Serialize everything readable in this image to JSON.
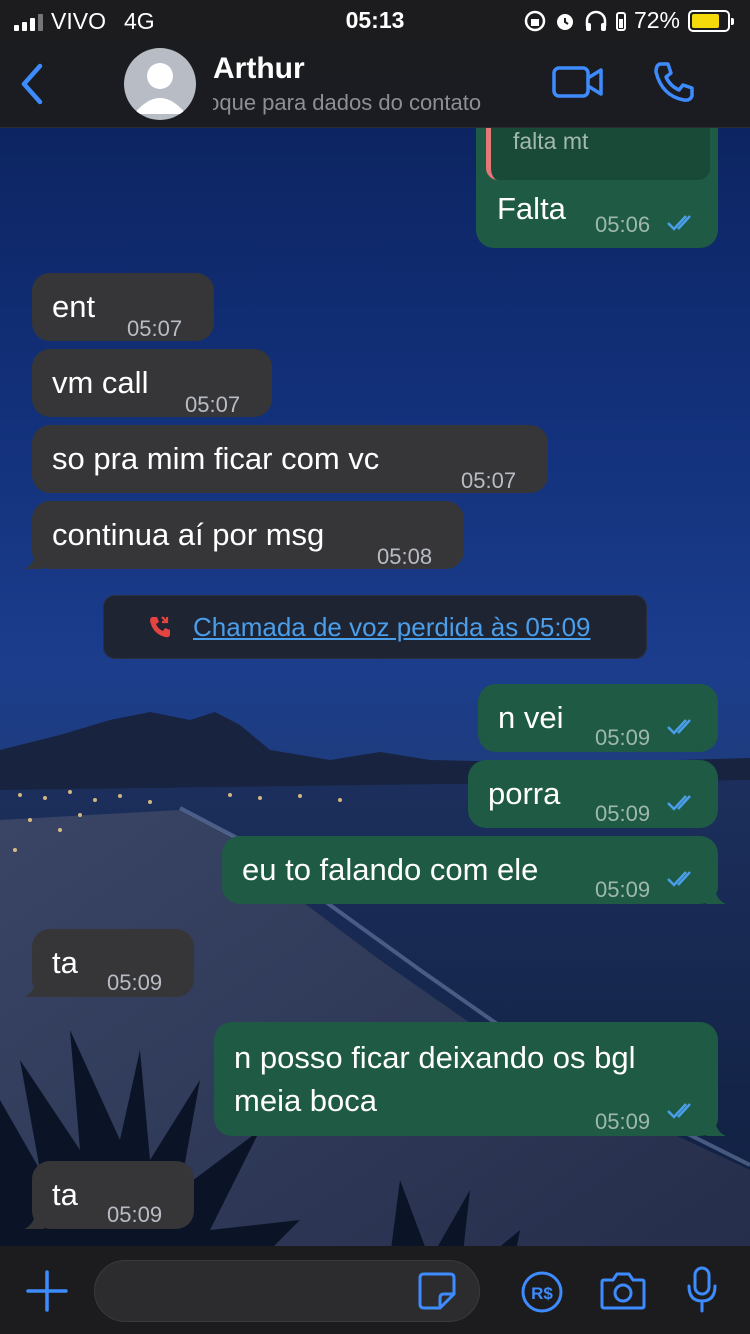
{
  "status_bar": {
    "carrier": "VIVO",
    "network": "4G",
    "time": "05:13",
    "battery": "72%",
    "battery_level": 0.72
  },
  "header": {
    "contact_name": "Arthur",
    "subtitle": "toque para dados do contato"
  },
  "quoted_reply": {
    "text": "falta mt"
  },
  "messages": [
    {
      "dir": "out",
      "text": "Falta",
      "time": "05:06",
      "read": true
    },
    {
      "dir": "in",
      "text": "ent",
      "time": "05:07"
    },
    {
      "dir": "in",
      "text": "vm call",
      "time": "05:07"
    },
    {
      "dir": "in",
      "text": "so pra mim ficar com vc",
      "time": "05:07"
    },
    {
      "dir": "in",
      "text": "continua aí por msg",
      "time": "05:08"
    },
    {
      "dir": "out",
      "text": "n vei",
      "time": "05:09",
      "read": true
    },
    {
      "dir": "out",
      "text": "porra",
      "time": "05:09",
      "read": true
    },
    {
      "dir": "out",
      "text": "eu to falando com ele",
      "time": "05:09",
      "read": true
    },
    {
      "dir": "in",
      "text": "ta",
      "time": "05:09"
    },
    {
      "dir": "out",
      "text_line1": "n posso ficar deixando os bgl",
      "text_line2": "meia boca",
      "time": "05:09",
      "read": true
    },
    {
      "dir": "in",
      "text": "ta",
      "time": "05:09"
    }
  ],
  "missed_call": {
    "text": "Chamada de voz perdida às 05:09"
  },
  "colors": {
    "incoming_bubble": "#363638",
    "outgoing_bubble": "#1f5a44",
    "accent": "#4a9eea",
    "missed_call_icon": "#e5433f"
  },
  "icons": {
    "back": "chevron-left-icon",
    "video": "video-camera-icon",
    "call": "phone-icon",
    "plus": "plus-icon",
    "sticker": "sticker-icon",
    "pay": "payment-icon",
    "camera": "camera-icon",
    "mic": "microphone-icon"
  }
}
